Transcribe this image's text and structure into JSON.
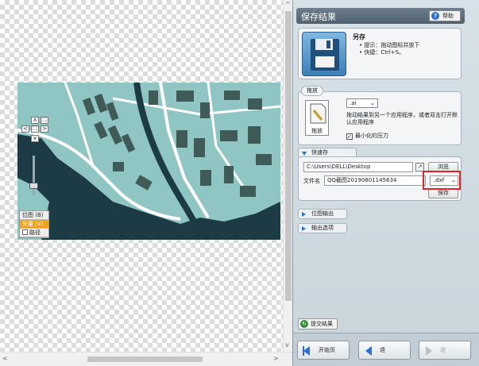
{
  "canvas": {
    "nav": {
      "up": "∧",
      "down": "∨",
      "left": "<",
      "right": ">",
      "center": "⛶",
      "fit": "⛶"
    },
    "view_modes": [
      {
        "label": "位图 (B)",
        "active": false
      },
      {
        "label": "矢量 (V)",
        "active": true
      },
      {
        "label": "路径",
        "active": false
      }
    ]
  },
  "panel": {
    "title": "保存结果",
    "help_label": "帮助",
    "save_as": {
      "title": "另存",
      "hint1": "• 提示：拖动图标并放下",
      "hint2": "• 快捷：Ctrl+S。"
    },
    "drag": {
      "group_label": "拖放",
      "format": ".ai",
      "icon_label": "拖放",
      "hint": "拖动结果到另一个应用程序，或者双击打开默认应用程序",
      "minimize_label": "最小化的压力",
      "minimize_checked": true
    },
    "quick_save": {
      "label": "快速存",
      "path": "C:\\Users\\DELL\\Desktop",
      "browse_label": "浏览",
      "filename_label": "文件名",
      "filename": "QQ截图20190801145634",
      "extension": ".dxf",
      "save_label": "保存"
    },
    "bitmap_output_label": "位图输出",
    "output_options_label": "输出选项",
    "submit_label": "提交结果",
    "footer": {
      "start_label": "开始页",
      "back_label": "退",
      "next_label": "进"
    }
  },
  "colors": {
    "map_water": "#1d3b44",
    "map_land": "#8fc6c3",
    "map_building": "#3f5a57",
    "highlight": "#e8202a",
    "accent": "#f3a21b"
  }
}
